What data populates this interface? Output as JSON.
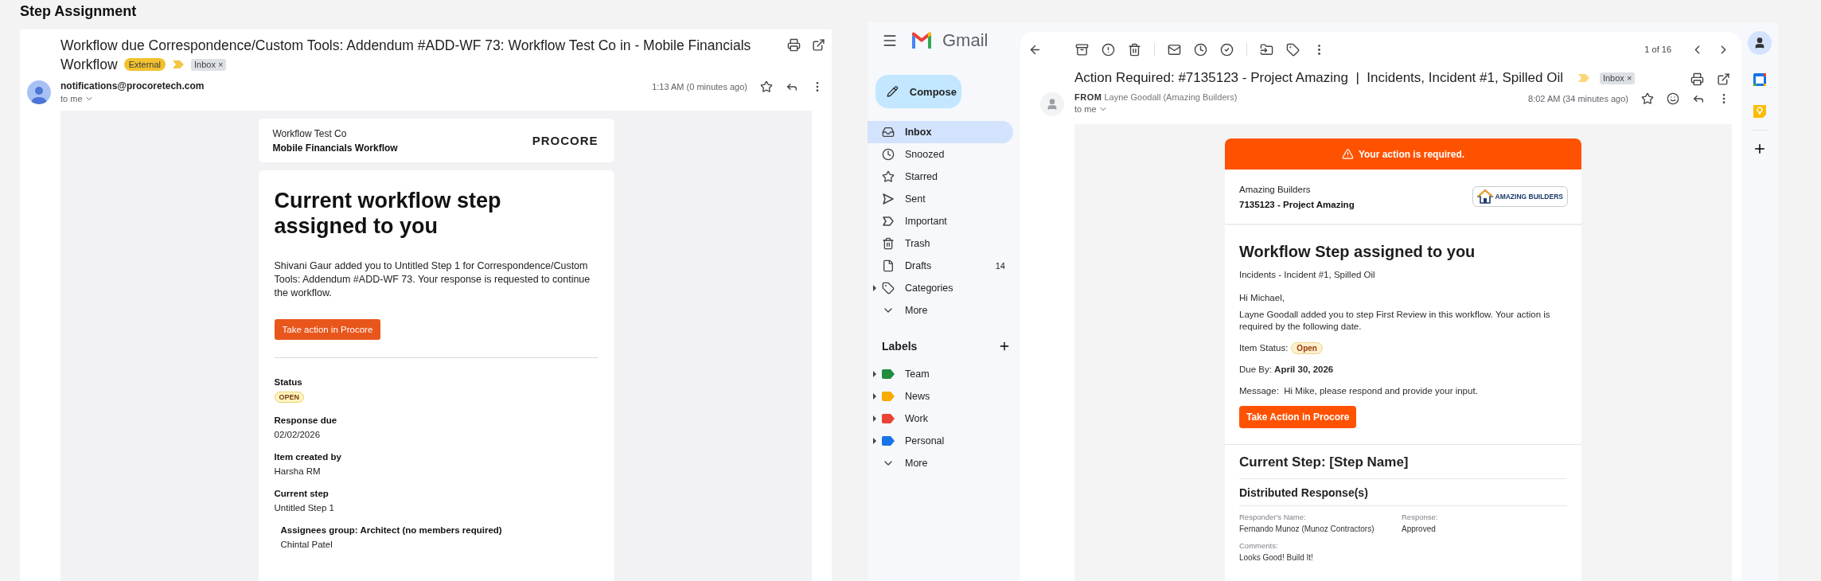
{
  "page_title": "Step Assignment",
  "procore_email": {
    "subject_lines": [
      "Workflow due Correspondence/Custom Tools: Addendum #ADD-WF 73: Workflow Test Co in - Mobile Financials",
      "Workflow"
    ],
    "external_badge": "External",
    "folder_chip": {
      "text": "Inbox",
      "remove": "×"
    },
    "sender": "notifications@procoretech.com",
    "recipient": "to me",
    "time": "1:13 AM (0 minutes ago)",
    "company": "Workflow Test Co",
    "workflow": "Mobile Financials Workflow",
    "logo_text": "PROCORE",
    "heading": "Current workflow step assigned to you",
    "message": "Shivani Gaur added you to Untitled Step 1 for Correspondence/Custom Tools: Addendum #ADD-WF 73. Your response is requested to continue the workflow.",
    "action_button": "Take action in Procore",
    "fields": [
      {
        "label": "Status",
        "value": "OPEN",
        "kind": "status"
      },
      {
        "label": "Response due",
        "value": "02/02/2026",
        "kind": "text"
      },
      {
        "label": "Item created by",
        "value": "Harsha RM",
        "kind": "text"
      },
      {
        "label": "Current step",
        "value": "Untitled Step 1",
        "kind": "text"
      }
    ],
    "assignees": {
      "group": "Assignees group: Architect (no members required)",
      "members": [
        "Chintal Patel"
      ]
    }
  },
  "gmail": {
    "app_name": "Gmail",
    "compose": "Compose",
    "nav": [
      {
        "label": "Inbox",
        "kind": "system",
        "selected": true
      },
      {
        "label": "Snoozed",
        "kind": "system",
        "selected": false
      },
      {
        "label": "Starred",
        "kind": "system",
        "selected": false
      },
      {
        "label": "Sent",
        "kind": "system",
        "selected": false
      },
      {
        "label": "Important",
        "kind": "system",
        "selected": false
      },
      {
        "label": "Trash",
        "kind": "system",
        "selected": false
      },
      {
        "label": "Drafts",
        "kind": "system",
        "selected": false,
        "count": "14"
      },
      {
        "label": "Categories",
        "kind": "group",
        "selected": false
      },
      {
        "label": "More",
        "kind": "more",
        "selected": false
      }
    ],
    "labels_heading": "Labels",
    "labels": [
      {
        "label": "Team",
        "kind": "label",
        "color": "#1e8e3e"
      },
      {
        "label": "News",
        "kind": "label",
        "color": "#f9ab00"
      },
      {
        "label": "Work",
        "kind": "label",
        "color": "#ea4335"
      },
      {
        "label": "Personal",
        "kind": "label",
        "color": "#1a73e8"
      },
      {
        "label": "More",
        "kind": "more"
      }
    ],
    "pager": "1 of 16",
    "subject": "Action Required: #7135123 - Project Amazing  |  Incidents, Incident #1, Spilled Oil",
    "folder_chip": {
      "text": "Inbox",
      "remove": "×"
    },
    "from_label": "FROM",
    "sender": "Layne Goodall (Amazing Builders)",
    "recipient": "to me",
    "time": "8:02 AM (34 minutes ago)",
    "banner": "Your action is required.",
    "company": "Amazing Builders",
    "project": "7135123 - Project Amazing",
    "logo_text": "AMAZING BUILDERS",
    "heading": "Workflow Step assigned to you",
    "item": "Incidents - Incident #1, Spilled Oil",
    "greeting": "Hi Michael,",
    "message": "Layne Goodall added you to step First Review in this workflow. Your action is required by the following date.",
    "status_label": "Item Status:",
    "status": "Open",
    "due": "Due By: **April 30, 2026**",
    "note": "Message:  Hi Mike, please respond and provide your input.",
    "action_button": "Take Action in Procore",
    "current_step": "Current Step: [Step Name]",
    "responses_heading": "Distributed Response(s)",
    "response_fields": [
      {
        "label": "Responder's Name:",
        "value": "Fernando Munoz (Munoz Contractors)"
      },
      {
        "label": "Response:",
        "value": "Approved"
      },
      {
        "label": "Comments:",
        "value": "Looks Good! Build It!"
      }
    ]
  }
}
